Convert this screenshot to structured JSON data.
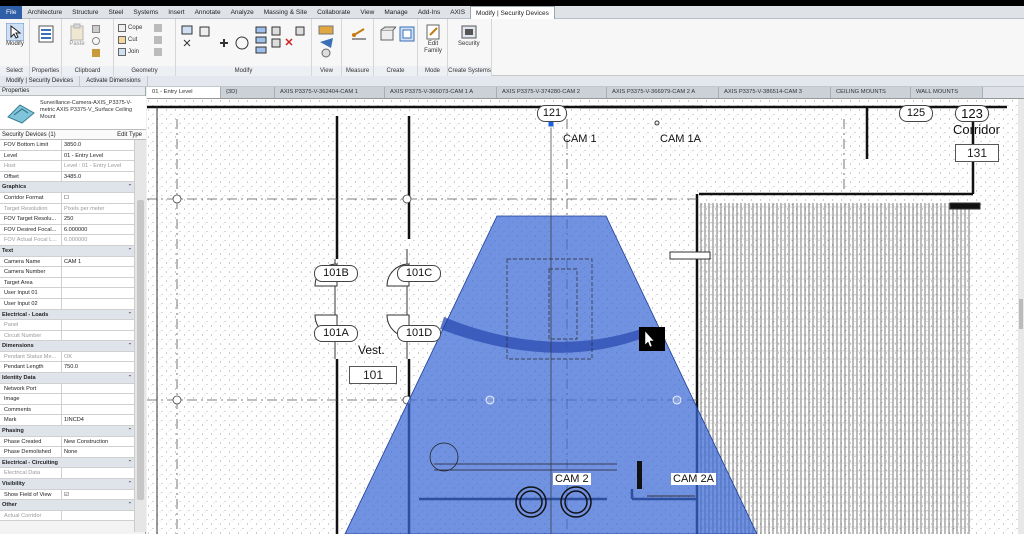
{
  "menu": {
    "tabs": [
      "File",
      "Architecture",
      "Structure",
      "Steel",
      "Systems",
      "Insert",
      "Annotate",
      "Analyze",
      "Massing & Site",
      "Collaborate",
      "View",
      "Manage",
      "Add-Ins",
      "AXIS",
      "Modify | Security Devices"
    ]
  },
  "ribbon": {
    "select": {
      "modify_label": "Modify",
      "group_label": "Select"
    },
    "properties": {
      "group_label": "Properties"
    },
    "clipboard": {
      "paste_label": "Paste",
      "group_label": "Clipboard"
    },
    "geometry": {
      "cope_label": "Cope",
      "cut_label": "Cut",
      "join_label": "Join",
      "group_label": "Geometry"
    },
    "modify": {
      "group_label": "Modify"
    },
    "view": {
      "group_label": "View"
    },
    "measure": {
      "group_label": "Measure"
    },
    "create": {
      "group_label": "Create"
    },
    "mode": {
      "edit_family_label": "Edit Family",
      "group_label": "Mode"
    },
    "create_systems": {
      "security_label": "Security",
      "group_label": "Create Systems"
    }
  },
  "context_bar": {
    "left": "Modify | Security Devices",
    "right": "Activate Dimensions"
  },
  "properties": {
    "title": "Properties",
    "type_name": "Surveillance-Camera-AXIS_P3375-V-metric AXIS P3375-V_Surface Ceiling Mount",
    "instance_filter": "Security Devices (1)",
    "edit_type": "Edit Type",
    "rows": [
      {
        "kind": "row",
        "label": "FOV Bottom Limit",
        "value": "3850.0"
      },
      {
        "kind": "row",
        "label": "Level",
        "value": "01 - Entry Level"
      },
      {
        "kind": "row",
        "label": "Host",
        "value": "Level : 01 - Entry Level",
        "grey": true
      },
      {
        "kind": "row",
        "label": "Offset",
        "value": "3485.0"
      },
      {
        "kind": "group",
        "label": "Graphics"
      },
      {
        "kind": "row",
        "label": "Corridor Format",
        "value": "☐"
      },
      {
        "kind": "row",
        "label": "Target Resolution",
        "value": "Pixels per meter",
        "grey": true
      },
      {
        "kind": "row",
        "label": "FOV Target Resolu...",
        "value": "250"
      },
      {
        "kind": "row",
        "label": "FOV Desired Focal...",
        "value": "6.000000"
      },
      {
        "kind": "row",
        "label": "FOV Actual Focal L...",
        "value": "6.000000",
        "grey": true
      },
      {
        "kind": "group",
        "label": "Text"
      },
      {
        "kind": "row",
        "label": "Camera Name",
        "value": "CAM 1"
      },
      {
        "kind": "row",
        "label": "Camera Number",
        "value": ""
      },
      {
        "kind": "row",
        "label": "Target Area",
        "value": ""
      },
      {
        "kind": "row",
        "label": "User Input 01",
        "value": ""
      },
      {
        "kind": "row",
        "label": "User Input 02",
        "value": ""
      },
      {
        "kind": "group",
        "label": "Electrical - Loads"
      },
      {
        "kind": "row",
        "label": "Panel",
        "value": "",
        "grey": true
      },
      {
        "kind": "row",
        "label": "Circuit Number",
        "value": "",
        "grey": true
      },
      {
        "kind": "group",
        "label": "Dimensions"
      },
      {
        "kind": "row",
        "label": "Pendant Status Me...",
        "value": "OK",
        "grey": true
      },
      {
        "kind": "row",
        "label": "Pendant Length",
        "value": "750.0"
      },
      {
        "kind": "group",
        "label": "Identity Data"
      },
      {
        "kind": "row",
        "label": "Network Port",
        "value": ""
      },
      {
        "kind": "row",
        "label": "Image",
        "value": ""
      },
      {
        "kind": "row",
        "label": "Comments",
        "value": ""
      },
      {
        "kind": "row",
        "label": "Mark",
        "value": "1INCD4"
      },
      {
        "kind": "group",
        "label": "Phasing"
      },
      {
        "kind": "row",
        "label": "Phase Created",
        "value": "New Construction"
      },
      {
        "kind": "row",
        "label": "Phase Demolished",
        "value": "None"
      },
      {
        "kind": "group",
        "label": "Electrical - Circuiting"
      },
      {
        "kind": "row",
        "label": "Electrical Data",
        "value": "",
        "grey": true
      },
      {
        "kind": "group",
        "label": "Visibility"
      },
      {
        "kind": "row",
        "label": "Show Field of View",
        "value": "☑"
      },
      {
        "kind": "group",
        "label": "Other"
      },
      {
        "kind": "row",
        "label": "Actual Corridor",
        "value": "",
        "grey": true
      }
    ]
  },
  "view_tabs": [
    "01 - Entry Level",
    "{3D}",
    "AXIS P3375-V-362404-CAM 1",
    "AXIS P3375-V-366073-CAM 1 A",
    "AXIS P3375-V-374280-CAM 2",
    "AXIS P3375-V-366979-CAM 2 A",
    "AXIS P3375-V-386514-CAM 3",
    "CEILING MOUNTS",
    "WALL MOUNTS"
  ],
  "plan": {
    "door_tags": [
      "101B",
      "101C",
      "101A",
      "101D"
    ],
    "room_name_vest": "Vest.",
    "room_num_vest": "101",
    "tag_121": "121",
    "tag_125": "125",
    "tag_123": "123",
    "room_name_corridor": "Corridor",
    "room_num_corridor": "131",
    "cam1": "CAM 1",
    "cam1a": "CAM 1A",
    "cam2": "CAM 2",
    "cam2a": "CAM 2A"
  },
  "colors": {
    "fov_fill": "#3a66d6",
    "fov_band": "#2f50b5",
    "file_tab": "#2f5fa6"
  }
}
